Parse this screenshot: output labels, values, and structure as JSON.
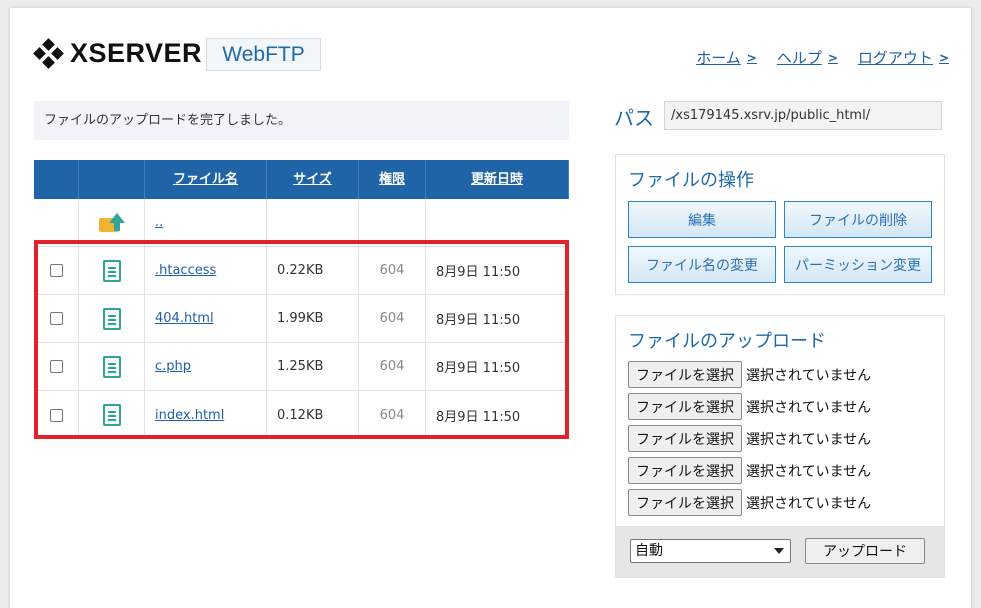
{
  "header": {
    "logo_text": "XSERVER",
    "product": "WebFTP",
    "nav": [
      {
        "label": "ホーム"
      },
      {
        "label": "ヘルプ"
      },
      {
        "label": "ログアウト"
      }
    ]
  },
  "message": "ファイルのアップロードを完了しました。",
  "table": {
    "headers": {
      "name": "ファイル名",
      "size": "サイズ",
      "perm": "権限",
      "date": "更新日時"
    },
    "parent_label": "..",
    "rows": [
      {
        "name": ".htaccess",
        "size": "0.22KB",
        "perm": "604",
        "date": "8月9日 11:50"
      },
      {
        "name": "404.html",
        "size": "1.99KB",
        "perm": "604",
        "date": "8月9日 11:50"
      },
      {
        "name": "c.php",
        "size": "1.25KB",
        "perm": "604",
        "date": "8月9日 11:50"
      },
      {
        "name": "index.html",
        "size": "0.12KB",
        "perm": "604",
        "date": "8月9日 11:50"
      }
    ]
  },
  "path": {
    "label": "パス",
    "value": "/xs179145.xsrv.jp/public_html/"
  },
  "operations": {
    "title": "ファイルの操作",
    "buttons": [
      "編集",
      "ファイルの削除",
      "ファイル名の変更",
      "パーミッション変更"
    ]
  },
  "upload": {
    "title": "ファイルのアップロード",
    "choose_label": "ファイルを選択",
    "no_file": "選択されていません",
    "mode": "自動",
    "submit": "アップロード"
  },
  "colors": {
    "accent": "#1f64a6",
    "highlight": "#e2222a",
    "icon": "#2aa79a"
  }
}
